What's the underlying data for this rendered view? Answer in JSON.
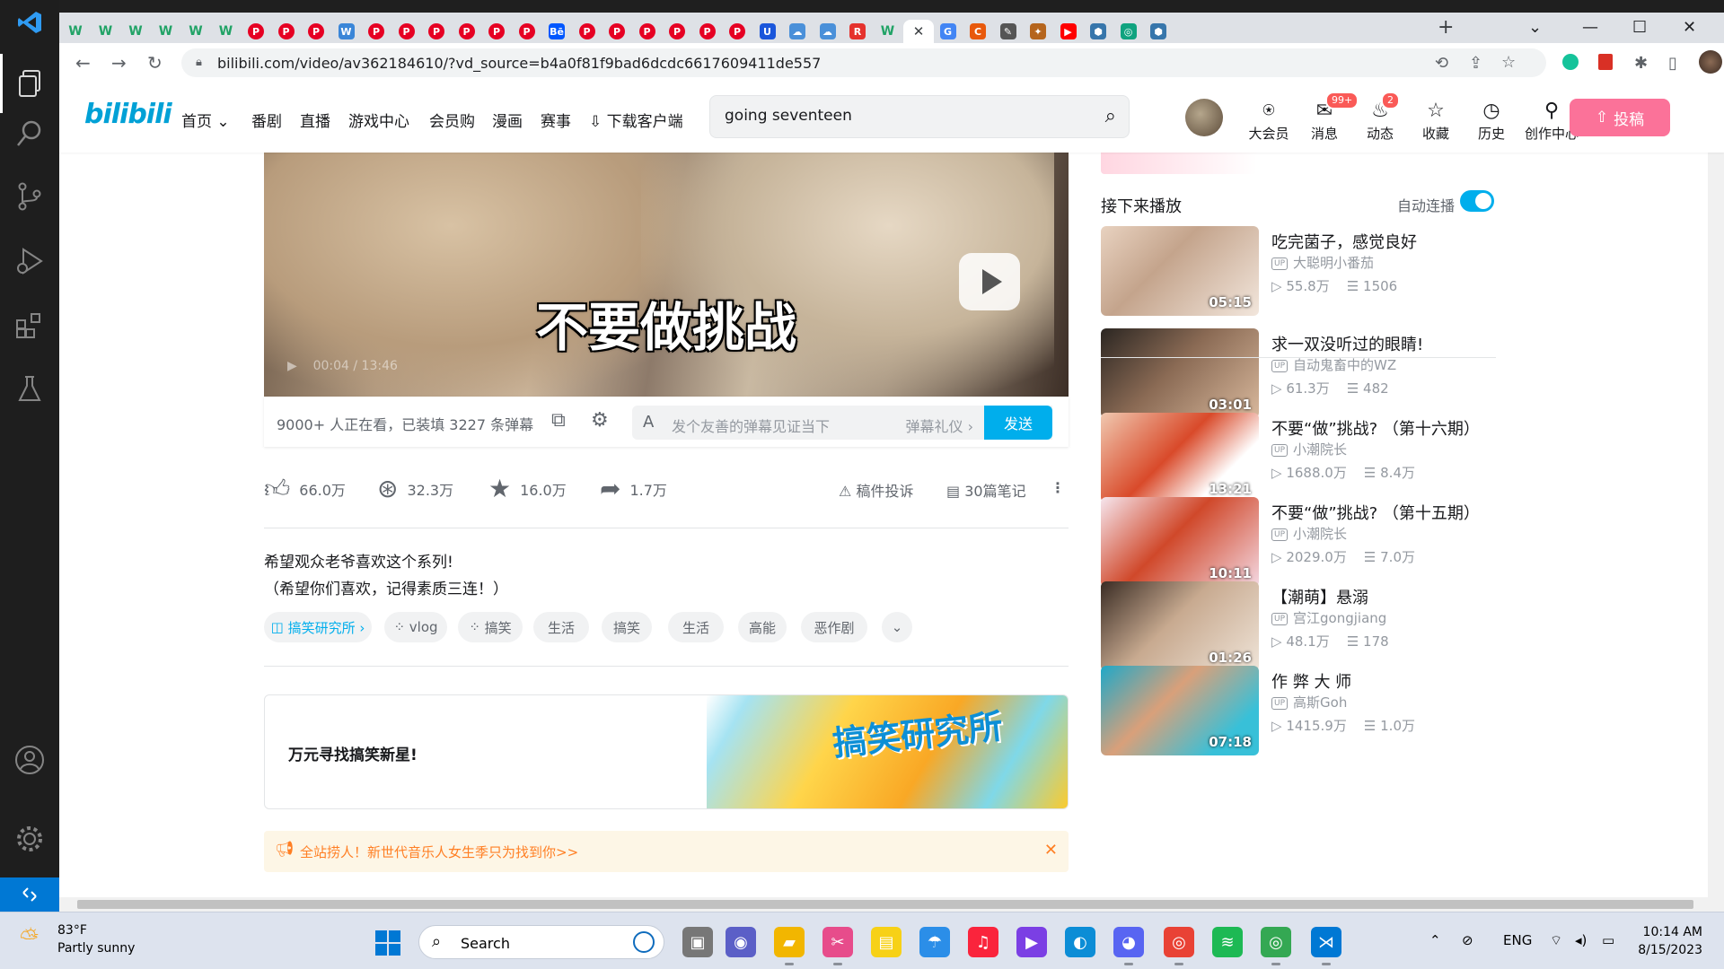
{
  "browser": {
    "url": "bilibili.com/video/av362184610/?vd_source=b4a0f81f9bad6dcdc6617609411de557",
    "tab_favicons": [
      "w",
      "w",
      "w",
      "w",
      "w",
      "w",
      "pinterest",
      "pinterest",
      "pinterest",
      "W",
      "pinterest",
      "pinterest",
      "pinterest",
      "pinterest",
      "pinterest",
      "pinterest",
      "Bē",
      "pinterest",
      "pinterest",
      "pinterest",
      "pinterest",
      "pinterest",
      "pinterest",
      "U",
      "cloud",
      "cloud",
      "R",
      "w",
      "bilibili-active",
      "G",
      "C",
      "pen",
      "puzzle",
      "youtube",
      "python",
      "chatgpt",
      "python"
    ]
  },
  "header": {
    "logo": "bilibili",
    "nav": [
      "首页",
      "番剧",
      "直播",
      "游戏中心",
      "会员购",
      "漫画",
      "赛事",
      "下载客户端"
    ],
    "search_value": "going seventeen",
    "icons": [
      {
        "label": "大会员",
        "icon": "vip-icon"
      },
      {
        "label": "消息",
        "icon": "message-icon",
        "badge": "99+"
      },
      {
        "label": "动态",
        "icon": "dynamic-icon",
        "badge": "2"
      },
      {
        "label": "收藏",
        "icon": "star-icon"
      },
      {
        "label": "历史",
        "icon": "clock-icon"
      },
      {
        "label": "创作中心",
        "icon": "bulb-icon"
      }
    ],
    "upload_label": "投稿",
    "colors": {
      "brand": "#00a1d6",
      "pink": "#fb7299",
      "blue": "#00aeec"
    }
  },
  "player": {
    "subtitle": "不要做挑战",
    "time": "00:04 / 13:46"
  },
  "danmaku": {
    "viewer_text": "9000+ 人正在看，已装填 3227 条弹幕",
    "placeholder": "发个友善的弹幕见证当下",
    "etiquette": "弹幕礼仪 ›",
    "send": "发送"
  },
  "actions": {
    "like": "66.0万",
    "coin": "32.3万",
    "fav": "16.0万",
    "share": "1.7万",
    "report": "稿件投诉",
    "notes": "30篇笔记"
  },
  "description": {
    "line1": "希望观众老爷喜欢这个系列!",
    "line2": "（希望你们喜欢，记得素质三连！）"
  },
  "tags": [
    "搞笑研究所 ›",
    "vlog",
    "搞笑",
    "生活",
    "搞笑",
    "生活",
    "高能",
    "恶作剧"
  ],
  "banner": {
    "text": "万元寻找搞笑新星!",
    "image_text": "搞笑研究所"
  },
  "notice": "全站捞人！新世代音乐人女生季只为找到你>>",
  "sidebar": {
    "next_title": "接下来播放",
    "autoplay": "自动连播",
    "items": [
      {
        "title": "吃完菌子，感觉良好",
        "up": "大聪明小番茄",
        "views": "55.8万",
        "danmaku": "1506",
        "dur": "05:15"
      },
      {
        "title": "求一双没听过的眼睛!",
        "up": "自动鬼畜中的WZ",
        "views": "61.3万",
        "danmaku": "482",
        "dur": "03:01"
      },
      {
        "title": "不要“做”挑战? （第十六期）",
        "up": "小潮院长",
        "views": "1688.0万",
        "danmaku": "8.4万",
        "dur": "13:21"
      },
      {
        "title": "不要“做”挑战? （第十五期）",
        "up": "小潮院长",
        "views": "2029.0万",
        "danmaku": "7.0万",
        "dur": "10:11"
      },
      {
        "title": "【潮萌】悬溺",
        "up": "宫江gongjiang",
        "views": "48.1万",
        "danmaku": "178",
        "dur": "01:26"
      },
      {
        "title": "作 弊 大 师",
        "up": "高斯Goh",
        "views": "1415.9万",
        "danmaku": "1.0万",
        "dur": "07:18"
      }
    ],
    "up_tag": "UP"
  },
  "taskbar": {
    "temp": "83°F",
    "weather": "Partly sunny",
    "search": "Search",
    "lang": "ENG",
    "time": "10:14 AM",
    "date": "8/15/2023"
  }
}
